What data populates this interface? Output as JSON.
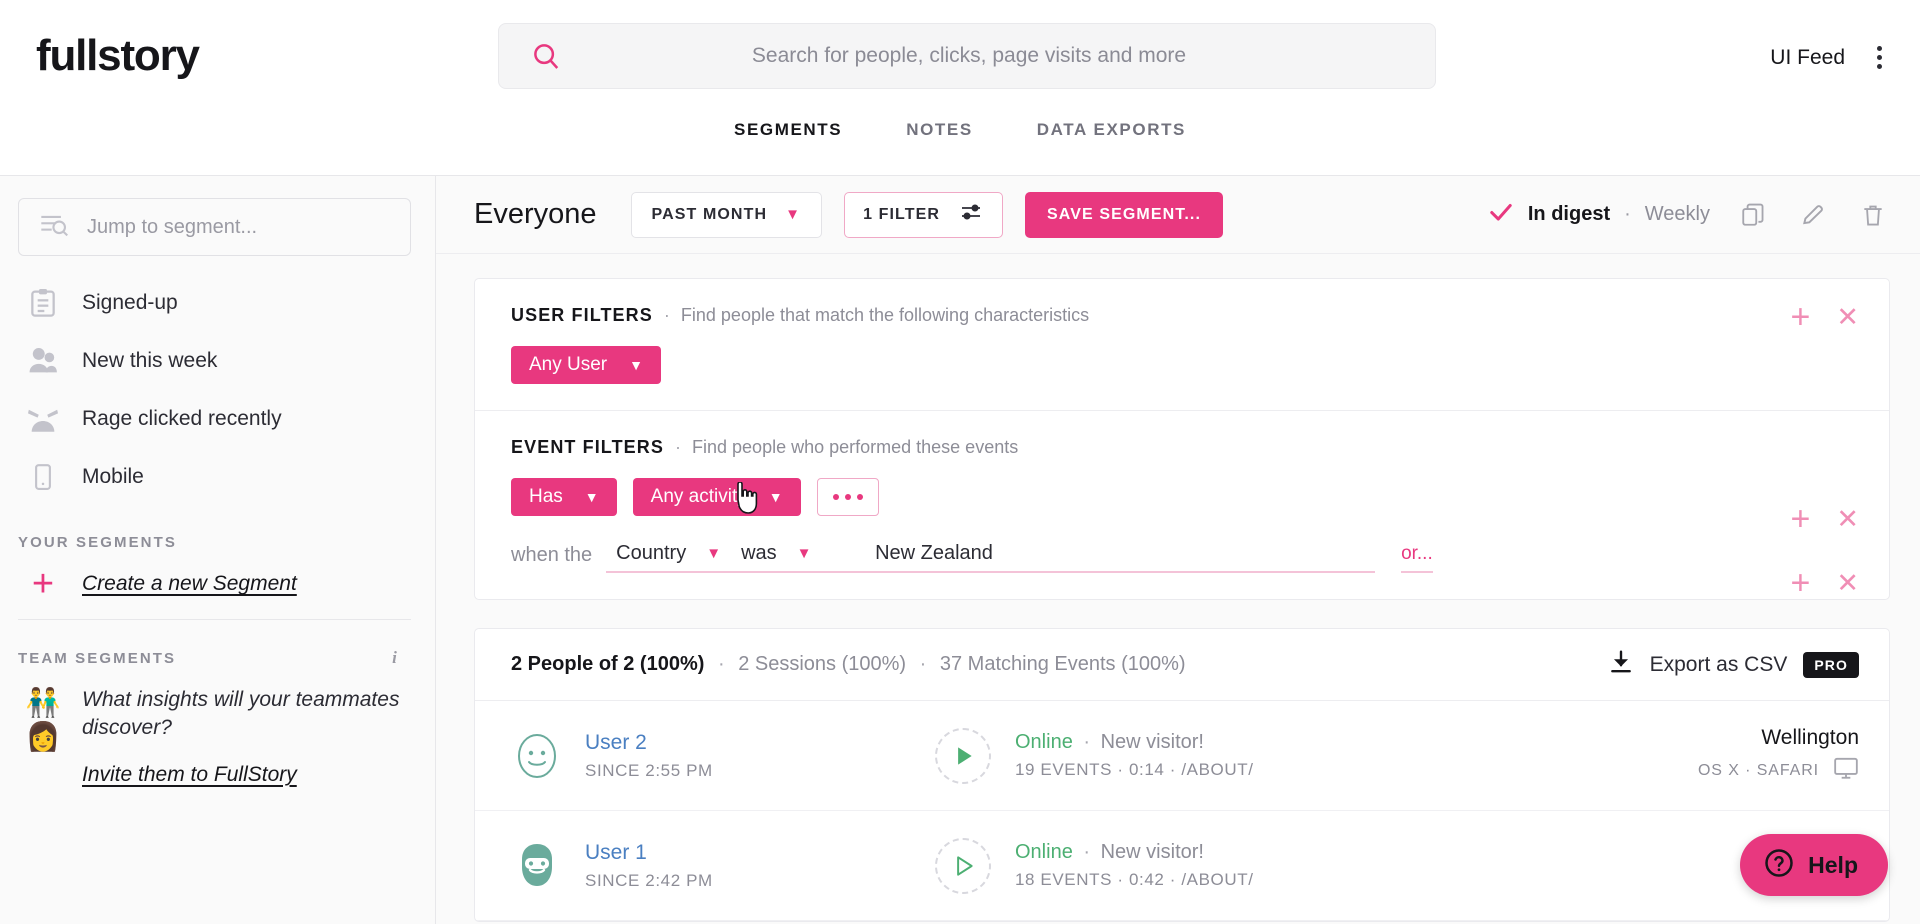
{
  "header": {
    "logo": "fullstory",
    "search": {
      "placeholder": "Search for people, clicks, page visits and more",
      "value": ""
    },
    "account": "UI Feed",
    "tabs": [
      {
        "label": "SEGMENTS",
        "active": true
      },
      {
        "label": "NOTES",
        "active": false
      },
      {
        "label": "DATA EXPORTS",
        "active": false
      }
    ]
  },
  "sidebar": {
    "jump_placeholder": "Jump to segment...",
    "items": [
      {
        "label": "Signed-up",
        "icon": "clipboard-icon"
      },
      {
        "label": "New this week",
        "icon": "people-icon"
      },
      {
        "label": "Rage clicked recently",
        "icon": "angry-face-icon"
      },
      {
        "label": "Mobile",
        "icon": "phone-icon"
      }
    ],
    "your_segments_header": "YOUR SEGMENTS",
    "create_label": "Create a new Segment",
    "team_segments_header": "TEAM SEGMENTS",
    "team_prompt": "What insights will your teammates discover?",
    "team_invite": "Invite them to FullStory"
  },
  "toolbar": {
    "segment_name": "Everyone",
    "date_range": "PAST MONTH",
    "filter_count": "1 FILTER",
    "save_label": "SAVE SEGMENT...",
    "digest_label": "In digest",
    "digest_sep": "·",
    "digest_value": "Weekly"
  },
  "filters": {
    "user": {
      "title": "USER FILTERS",
      "sep": "·",
      "description": "Find people that match the following characteristics",
      "pill": "Any User"
    },
    "event": {
      "title": "EVENT FILTERS",
      "sep": "·",
      "description": "Find people who performed these events",
      "pill_verb": "Has",
      "pill_activity": "Any activity",
      "when_label": "when the",
      "property": "Country",
      "operator": "was",
      "value": "New Zealand",
      "or_label": "or..."
    }
  },
  "results": {
    "people_count": "2 People of 2 (100%)",
    "sessions_count": "2 Sessions (100%)",
    "events_count": "37 Matching Events (100%)",
    "sep": "·",
    "export_label": "Export as CSV",
    "pro_badge": "PRO",
    "rows": [
      {
        "name": "User 2",
        "since": "SINCE 2:55 PM",
        "status": "Online",
        "visitor": "New visitor!",
        "meta": "19 EVENTS · 0:14 · /ABOUT/",
        "city": "Wellington",
        "device": "OS X · SAFARI",
        "avatar": "smiley-avatar",
        "play_state": "filled"
      },
      {
        "name": "User 1",
        "since": "SINCE 2:42 PM",
        "status": "Online",
        "visitor": "New visitor!",
        "meta": "18 EVENTS · 0:42 · /ABOUT/",
        "city": "",
        "device": "",
        "avatar": "beard-avatar",
        "play_state": "outline"
      }
    ]
  },
  "help": {
    "label": "Help"
  },
  "colors": {
    "accent_pink": "#e8387f",
    "accent_pink_light": "#f0a8c6",
    "link_blue": "#4a7fc1",
    "online_green": "#4caf72",
    "text_dark": "#16161a",
    "text_muted": "#8d8d97"
  }
}
